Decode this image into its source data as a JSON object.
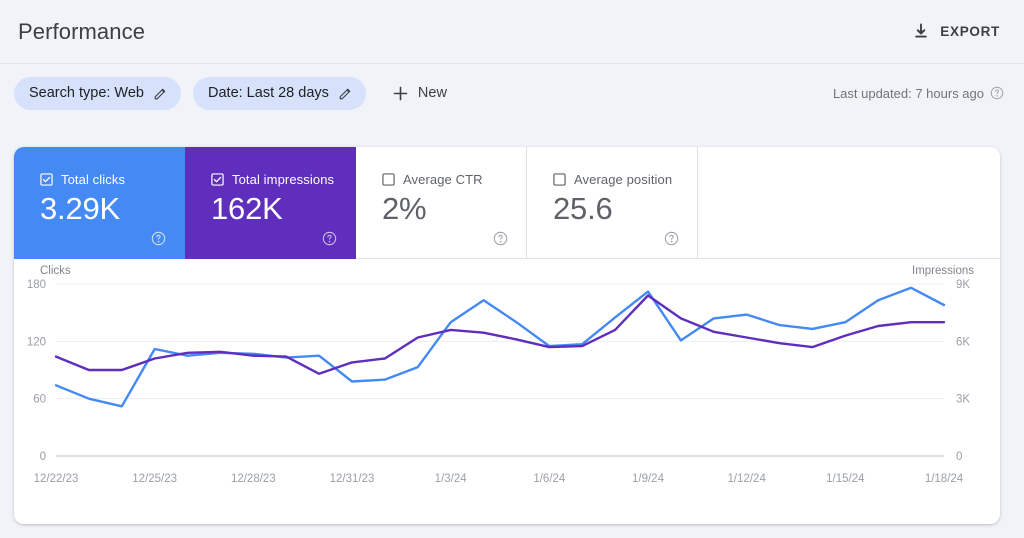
{
  "header": {
    "title": "Performance",
    "export_label": "EXPORT",
    "export_icon": "download-icon"
  },
  "filters": {
    "chips": [
      {
        "label": "Search type: Web",
        "edit_icon": "pencil-icon"
      },
      {
        "label": "Date: Last 28 days",
        "edit_icon": "pencil-icon"
      }
    ],
    "new_label": "New",
    "new_icon": "plus-icon",
    "last_updated": "Last updated: 7 hours ago",
    "help_icon": "help-circle-icon"
  },
  "metrics": [
    {
      "label": "Total clicks",
      "value": "3.29K",
      "checked": true,
      "color": "#4589f4",
      "help_icon": "help-circle-icon"
    },
    {
      "label": "Total impressions",
      "value": "162K",
      "checked": true,
      "color": "#5f2ebd",
      "help_icon": "help-circle-icon"
    },
    {
      "label": "Average CTR",
      "value": "2%",
      "checked": false,
      "color": "#e0e0e0",
      "help_icon": "help-circle-icon"
    },
    {
      "label": "Average position",
      "value": "25.6",
      "checked": false,
      "color": "#e0e0e0",
      "help_icon": "help-circle-icon"
    }
  ],
  "chart_data": {
    "type": "line",
    "title": "",
    "xlabel": "",
    "ylabel": "Clicks",
    "y2label": "Impressions",
    "grid": true,
    "legend": "none",
    "ylim": [
      0,
      180
    ],
    "y2lim": [
      0,
      9000
    ],
    "yticks": [
      0,
      60,
      120,
      180
    ],
    "ytick_labels": [
      "0",
      "60",
      "120",
      "180"
    ],
    "y2ticks": [
      0,
      3000,
      6000,
      9000
    ],
    "y2tick_labels": [
      "0",
      "3K",
      "6K",
      "9K"
    ],
    "x_tick_labels": [
      "12/22/23",
      "12/25/23",
      "12/28/23",
      "12/31/23",
      "1/3/24",
      "1/6/24",
      "1/9/24",
      "1/12/24",
      "1/15/24",
      "1/18/24"
    ],
    "x_tick_indices": [
      0,
      3,
      6,
      9,
      12,
      15,
      18,
      21,
      24,
      27
    ],
    "dates": [
      "12/22/23",
      "12/23/23",
      "12/24/23",
      "12/25/23",
      "12/26/23",
      "12/27/23",
      "12/28/23",
      "12/29/23",
      "12/30/23",
      "12/31/23",
      "1/1/24",
      "1/2/24",
      "1/3/24",
      "1/4/24",
      "1/5/24",
      "1/6/24",
      "1/7/24",
      "1/8/24",
      "1/9/24",
      "1/10/24",
      "1/11/24",
      "1/12/24",
      "1/13/24",
      "1/14/24",
      "1/15/24",
      "1/16/24",
      "1/17/24",
      "1/18/24"
    ],
    "series": [
      {
        "name": "Clicks",
        "axis": "left",
        "color": "#4589f4",
        "values": [
          74,
          60,
          52,
          112,
          105,
          108,
          107,
          103,
          105,
          78,
          80,
          93,
          140,
          163,
          140,
          115,
          117,
          145,
          172,
          121,
          144,
          148,
          137,
          133,
          140,
          163,
          176,
          158
        ]
      },
      {
        "name": "Impressions",
        "axis": "right",
        "color": "#5f2ebd",
        "values": [
          5200,
          4500,
          4500,
          5100,
          5400,
          5450,
          5250,
          5200,
          4300,
          4900,
          5100,
          6200,
          6600,
          6450,
          6100,
          5700,
          5750,
          6600,
          8400,
          7200,
          6500,
          6200,
          5900,
          5700,
          6300,
          6800,
          7000,
          7000
        ]
      }
    ]
  }
}
